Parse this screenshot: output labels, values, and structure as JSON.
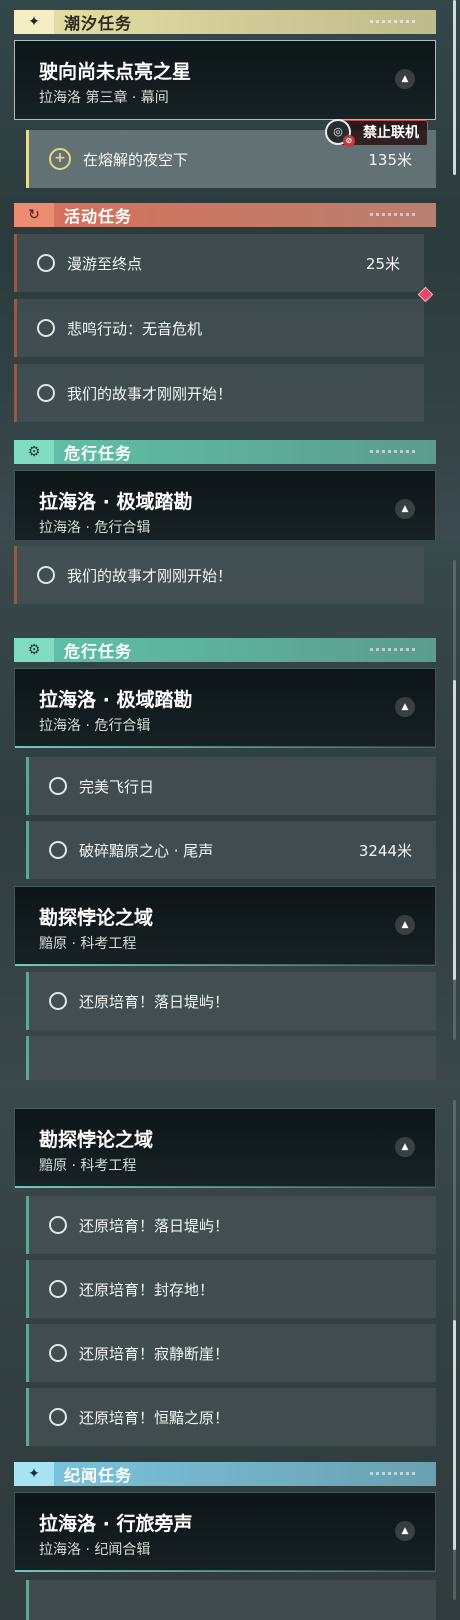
{
  "panel1": {
    "tide_category": {
      "label": "潮汐任务",
      "icon": "sparkle-icon"
    },
    "chapter": {
      "title": "驶向尚未点亮之星",
      "subtitle": "拉海洛 第三章 · 幕间"
    },
    "tracked_task": {
      "label": "在熔解的夜空下",
      "distance": "135米",
      "icon": "plus-circle-icon"
    },
    "no_multiplayer": "禁止联机",
    "event_category": {
      "label": "活动任务",
      "icon": "return-arrow-icon"
    },
    "event_tasks": [
      {
        "label": "漫游至终点",
        "distance": "25米"
      },
      {
        "label": "悲鸣行动：无音危机"
      },
      {
        "label": "我们的故事才刚刚开始！"
      }
    ],
    "danger_category": {
      "label": "危行任务",
      "icon": "gear-eye-icon"
    },
    "danger_chapter": {
      "title": "拉海洛 · 极域踏勘",
      "subtitle": "拉海洛 · 危行合辑"
    }
  },
  "panel2": {
    "event_task_last": "我们的故事才刚刚开始！",
    "danger_category": {
      "label": "危行任务"
    },
    "danger_chapter": {
      "title": "拉海洛 · 极域踏勘",
      "subtitle": "拉海洛 · 危行合辑"
    },
    "danger_tasks": [
      {
        "label": "完美飞行日"
      },
      {
        "label": "破碎黯原之心 · 尾声",
        "distance": "3244米"
      }
    ],
    "explore_chapter": {
      "title": "勘探悖论之域",
      "subtitle": "黯原 · 科考工程"
    },
    "explore_tasks": [
      {
        "label": "还原培育！落日堤屿！"
      }
    ]
  },
  "panel3": {
    "explore_chapter": {
      "title": "勘探悖论之域",
      "subtitle": "黯原 · 科考工程"
    },
    "explore_tasks": [
      {
        "label": "还原培育！落日堤屿！"
      },
      {
        "label": "还原培育！封存地！"
      },
      {
        "label": "还原培育！寂静断崖！"
      },
      {
        "label": "还原培育！恒黯之原！"
      }
    ],
    "lore_category": {
      "label": "纪闻任务",
      "icon": "sparkle-icon"
    },
    "lore_chapter": {
      "title": "拉海洛 · 行旅旁声",
      "subtitle": "拉海洛 · 纪闻合辑"
    }
  },
  "icons": {
    "collapse": "chevron-up-icon",
    "radio": "circle-icon"
  },
  "colors": {
    "tide": "#e7e0a6",
    "event": "#d9705b",
    "danger": "#5fc3a8",
    "lore": "#7ac6df",
    "alert": "#c14a4a"
  }
}
